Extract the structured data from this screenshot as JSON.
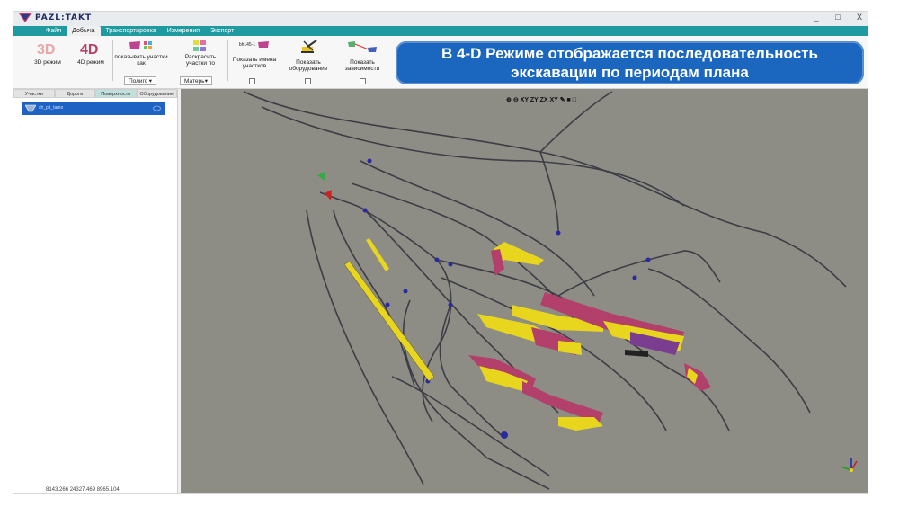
{
  "app": {
    "logo_text": "PAZL:TAKT",
    "window_controls": [
      "_",
      "□",
      "X"
    ]
  },
  "menu": [
    "Файл",
    "Добыча",
    "Транспортировка",
    "Измерения",
    "Экспорт"
  ],
  "menu_active": "Добыча",
  "ribbon": {
    "mode3d_label": "3D режим",
    "mode4d_label": "4D режим",
    "show_sections_label": "показывать участки как",
    "show_sections_value": "Полигс",
    "color_sections_label": "Раскрасить участки по",
    "color_sections_value": "Матерь",
    "section_tag": "bh145-1",
    "show_names_label": "Показать имена участков",
    "show_equipment_label": "Показать оборудование",
    "show_deps_label": "Показать зависимости"
  },
  "banner": {
    "line1": "В 4-D Режиме отображается последовательность",
    "line2": "экскавации по периодам плана"
  },
  "left_panel": {
    "tabs": [
      "Участки",
      "Дороги",
      "Поверхности",
      "Оборудование"
    ],
    "active_tab": "Поверхности",
    "layer_name": "sh_pit_tamo",
    "coords": "8143.266   24327.469   8965.104"
  },
  "viewport": {
    "view_buttons": [
      "XY",
      "ZY",
      "ZX",
      "XY"
    ],
    "colors": {
      "road": "#3d3d45",
      "yellow": "#e8d61e",
      "magenta": "#b3406a",
      "purple": "#7a3d8f",
      "node": "#2a2aa0"
    }
  }
}
